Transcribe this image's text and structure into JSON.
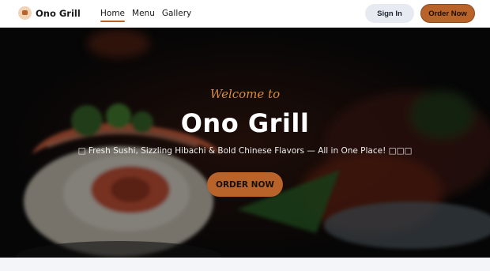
{
  "nav": {
    "brand": "Ono Grill",
    "logo_icon": "grill-logo-icon",
    "links": [
      {
        "label": "Home",
        "active": true
      },
      {
        "label": "Menu",
        "active": false
      },
      {
        "label": "Gallery",
        "active": false
      }
    ],
    "sign_in_label": "Sign In",
    "order_now_label": "Order Now"
  },
  "hero": {
    "welcome": "Welcome to",
    "title": "Ono Grill",
    "tagline": "□ Fresh Sushi, Sizzling Hibachi & Bold Chinese Flavors — All in One Place! □□□",
    "cta_label": "ORDER NOW",
    "background": "sushi-roll-photo"
  },
  "colors": {
    "accent": "#b8632a",
    "welcome_text": "#d98a45",
    "signin_bg": "#e7ebf1"
  }
}
